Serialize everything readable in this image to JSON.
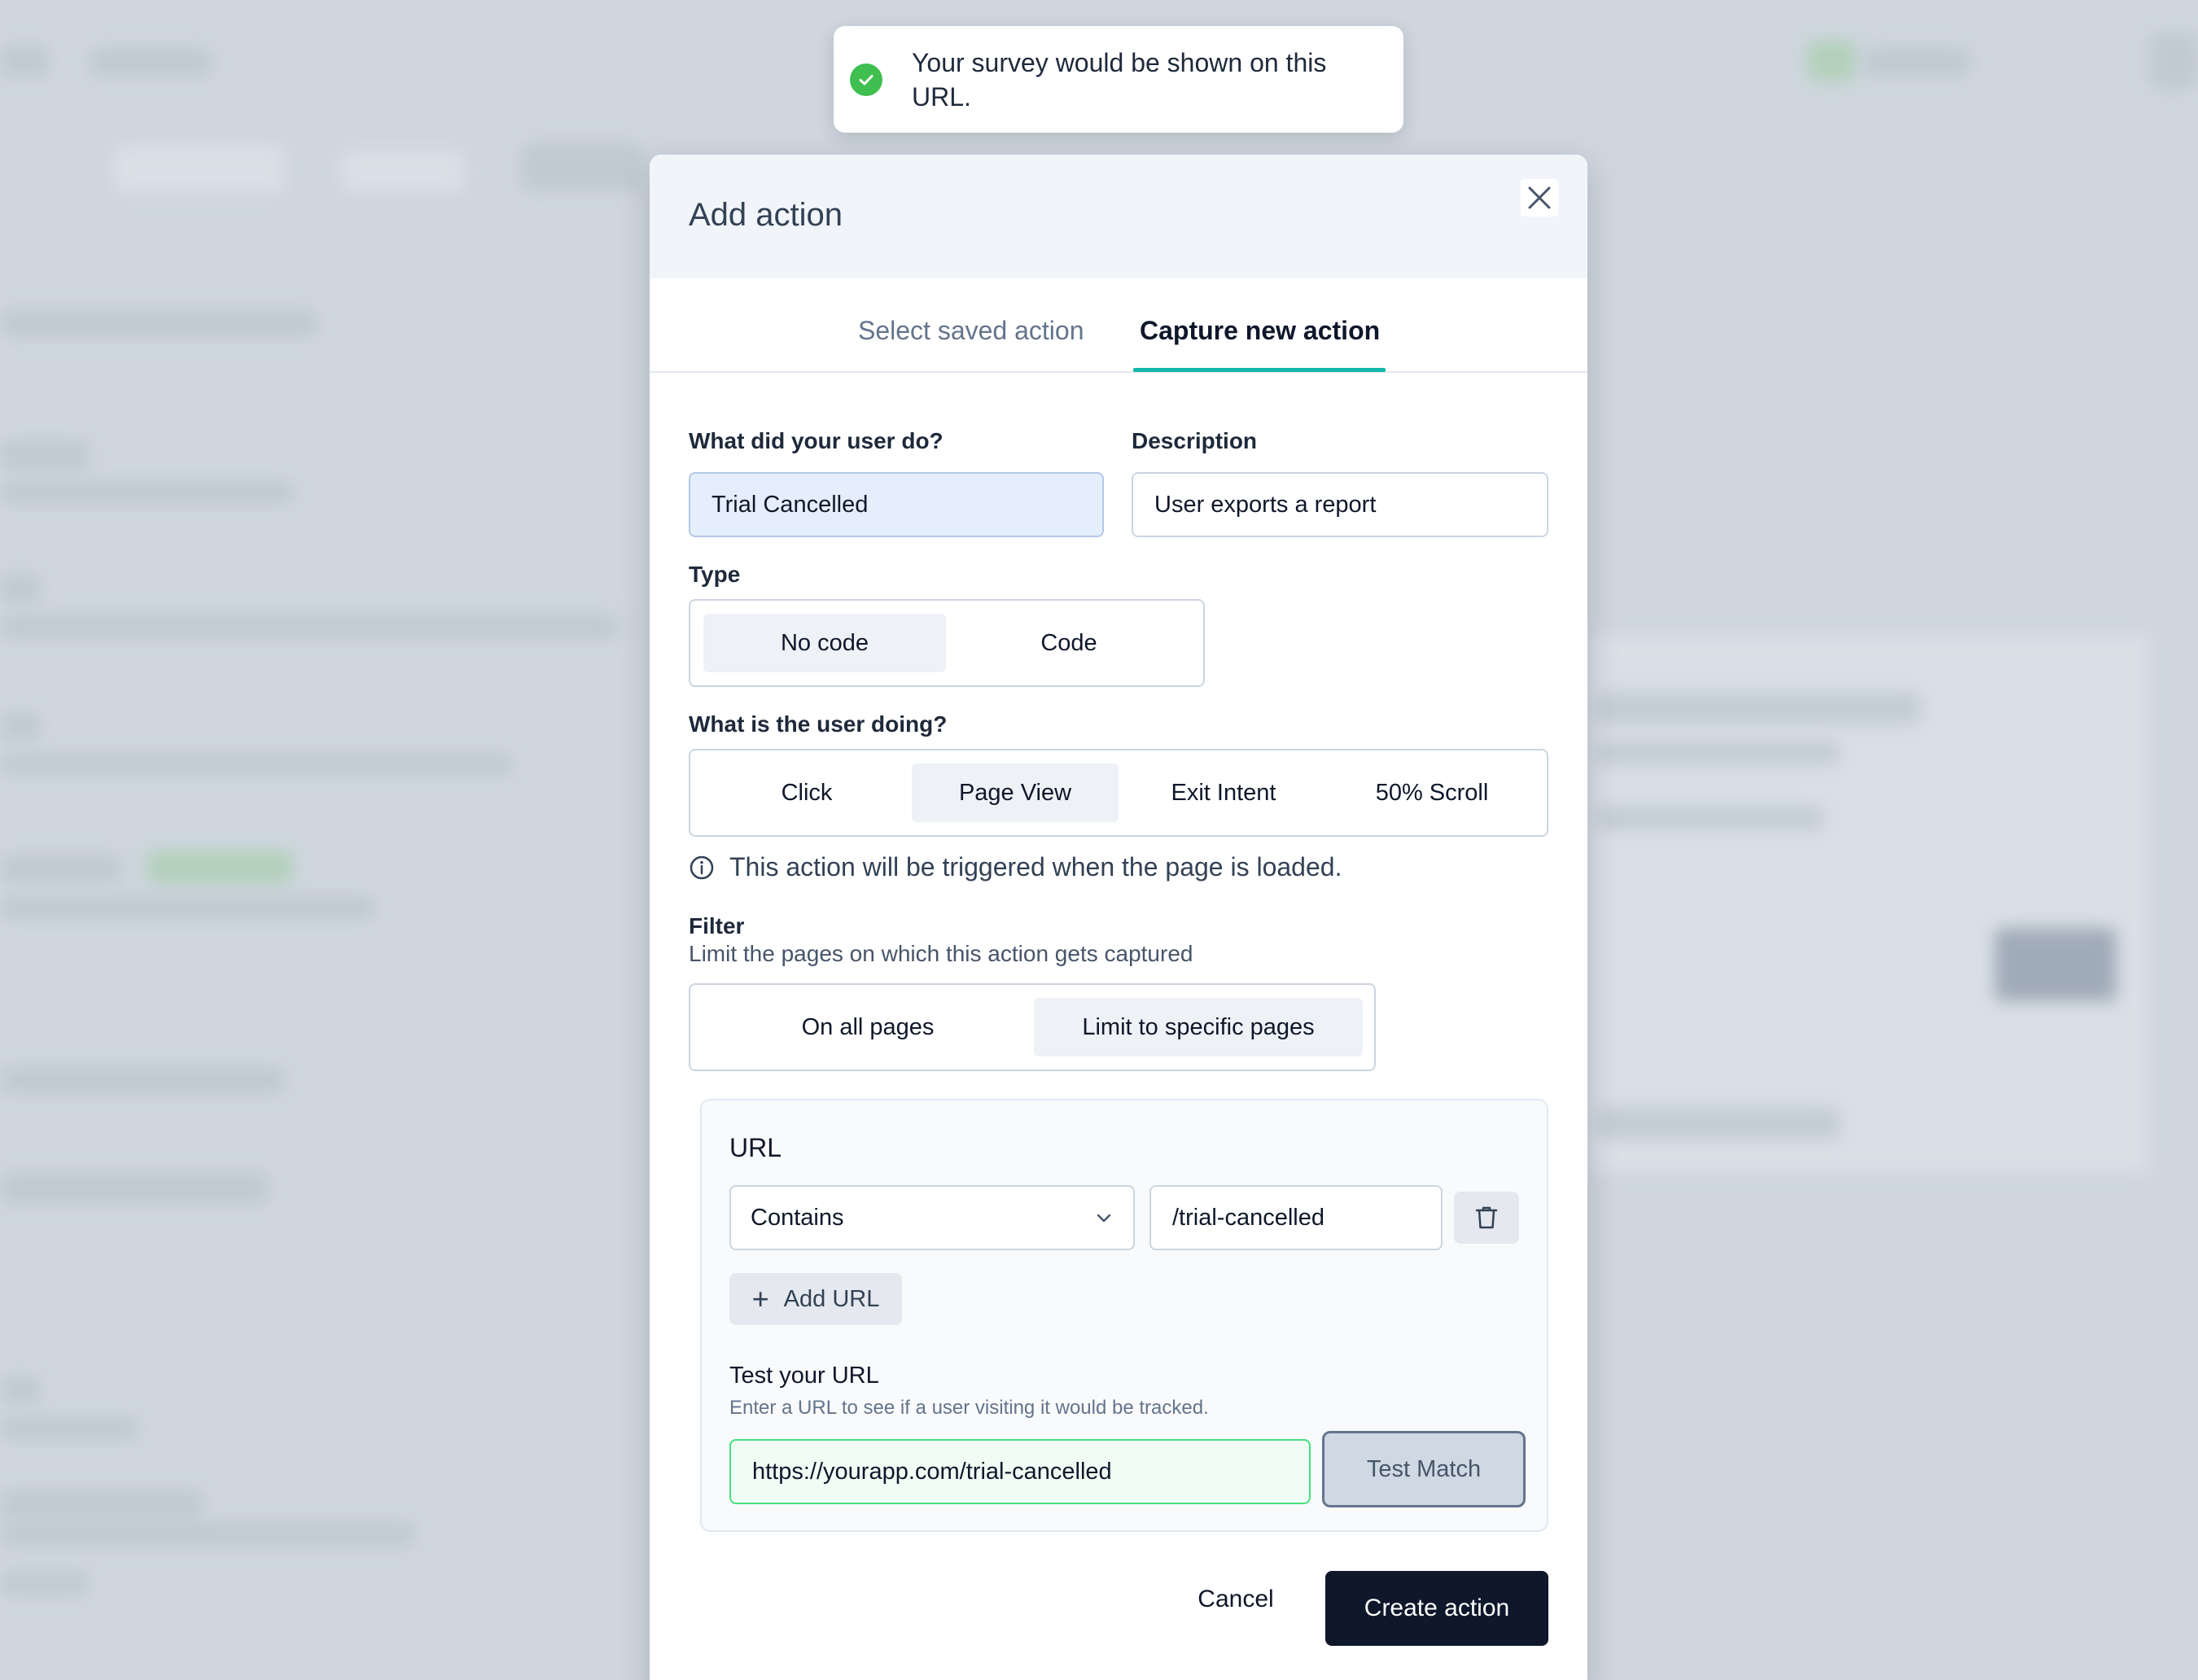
{
  "toast": {
    "icon": "check-circle-icon",
    "message": "Your survey would be shown on this URL."
  },
  "modal": {
    "title": "Add action",
    "close_icon": "close-icon"
  },
  "tabs": [
    {
      "label": "Select saved action",
      "active": false
    },
    {
      "label": "Capture new action",
      "active": true
    }
  ],
  "form": {
    "name_label": "What did your user do?",
    "name_value": "Trial Cancelled",
    "description_label": "Description",
    "description_value": "User exports a report",
    "type_label": "Type",
    "type_options": [
      {
        "label": "No code",
        "active": true
      },
      {
        "label": "Code",
        "active": false
      }
    ],
    "doing_label": "What is the user doing?",
    "doing_options": [
      {
        "label": "Click",
        "active": false
      },
      {
        "label": "Page View",
        "active": true
      },
      {
        "label": "Exit Intent",
        "active": false
      },
      {
        "label": "50% Scroll",
        "active": false
      }
    ],
    "info_text": "This action will be triggered when the page is loaded.",
    "filter_label": "Filter",
    "filter_sub": "Limit the pages on which this action gets captured",
    "filter_options": [
      {
        "label": "On all pages",
        "active": false
      },
      {
        "label": "Limit to specific pages",
        "active": true
      }
    ]
  },
  "url_panel": {
    "title": "URL",
    "match_type": "Contains",
    "url_value": "/trial-cancelled",
    "add_url_label": "Add URL",
    "test_title": "Test your URL",
    "test_sub": "Enter a URL to see if a user visiting it would be tracked.",
    "test_url_value": "https://yourapp.com/trial-cancelled",
    "test_button_label": "Test Match"
  },
  "footer": {
    "cancel_label": "Cancel",
    "create_label": "Create action"
  },
  "colors": {
    "accent": "#14b8a6",
    "primary_button": "#0f172a",
    "success": "#3fbf4f"
  }
}
